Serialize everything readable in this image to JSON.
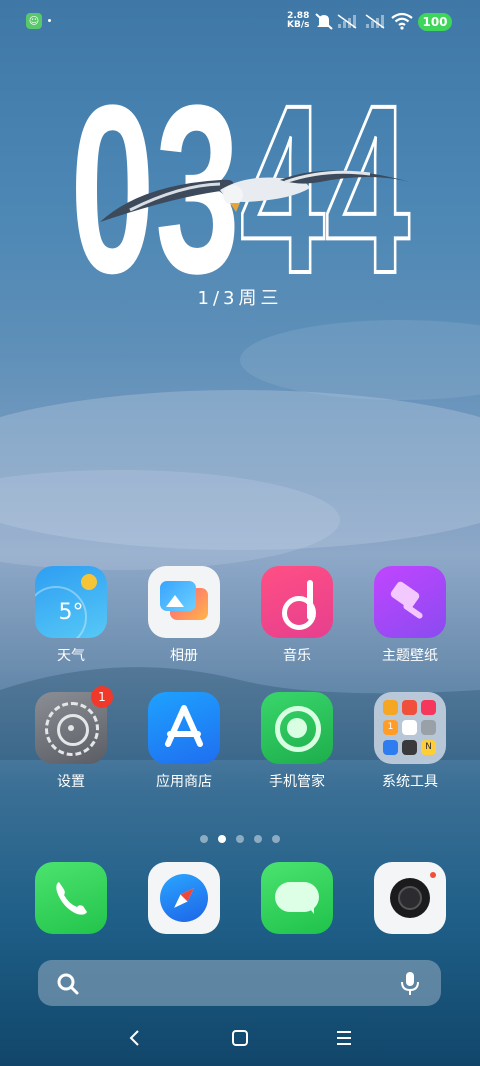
{
  "status_bar": {
    "network_speed_value": "2.88",
    "network_speed_unit": "KB/s",
    "battery": "100"
  },
  "clock": {
    "hours": "03",
    "minutes": "44",
    "date": "1/3周三"
  },
  "home_apps": [
    {
      "label": "天气",
      "icon": "weather-icon",
      "value": "5°"
    },
    {
      "label": "相册",
      "icon": "gallery-icon"
    },
    {
      "label": "音乐",
      "icon": "music-icon"
    },
    {
      "label": "主题壁纸",
      "icon": "theme-icon"
    },
    {
      "label": "设置",
      "icon": "settings-icon",
      "badge": "1"
    },
    {
      "label": "应用商店",
      "icon": "app-store-icon"
    },
    {
      "label": "手机管家",
      "icon": "phone-manager-icon"
    },
    {
      "label": "系统工具",
      "icon": "system-tools-folder-icon"
    }
  ],
  "folder_mini_labels": {
    "calendar": "1",
    "notes": "N"
  },
  "page_indicator": {
    "count": 5,
    "active": 2
  },
  "dock": [
    {
      "icon": "phone-icon"
    },
    {
      "icon": "browser-icon"
    },
    {
      "icon": "messages-icon"
    },
    {
      "icon": "camera-icon"
    }
  ],
  "colors": {
    "battery": "#3ed55a",
    "badge": "#f0392b"
  }
}
